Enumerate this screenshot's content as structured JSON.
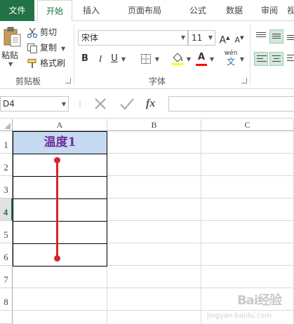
{
  "tabs": {
    "file": "文件",
    "home": "开始",
    "insert": "插入",
    "page_layout": "页面布局",
    "formulas": "公式",
    "data": "数据",
    "review": "审阅",
    "view": "视"
  },
  "clipboard": {
    "paste": "粘贴",
    "cut": "剪切",
    "copy": "复制",
    "format_painter": "格式刷",
    "group_label": "剪贴板"
  },
  "font": {
    "name": "宋体",
    "size": "11",
    "bold": "B",
    "italic": "I",
    "underline": "U",
    "grow": "A",
    "shrink": "A",
    "phonetic_top": "wén",
    "phonetic_bottom": "文",
    "group_label": "字体",
    "fill_color": "#ffff00",
    "font_color": "#ff0000"
  },
  "formula_bar": {
    "name_box": "D4",
    "fx": "fx"
  },
  "grid": {
    "columns": [
      "A",
      "B",
      "C"
    ],
    "rows": [
      "1",
      "2",
      "3",
      "4",
      "5",
      "6",
      "7",
      "8"
    ],
    "selected_row": "4",
    "cells": {
      "A1": "温度1"
    }
  },
  "watermark": {
    "main": "Bai经验",
    "sub": "jingyan.baidu.com"
  }
}
